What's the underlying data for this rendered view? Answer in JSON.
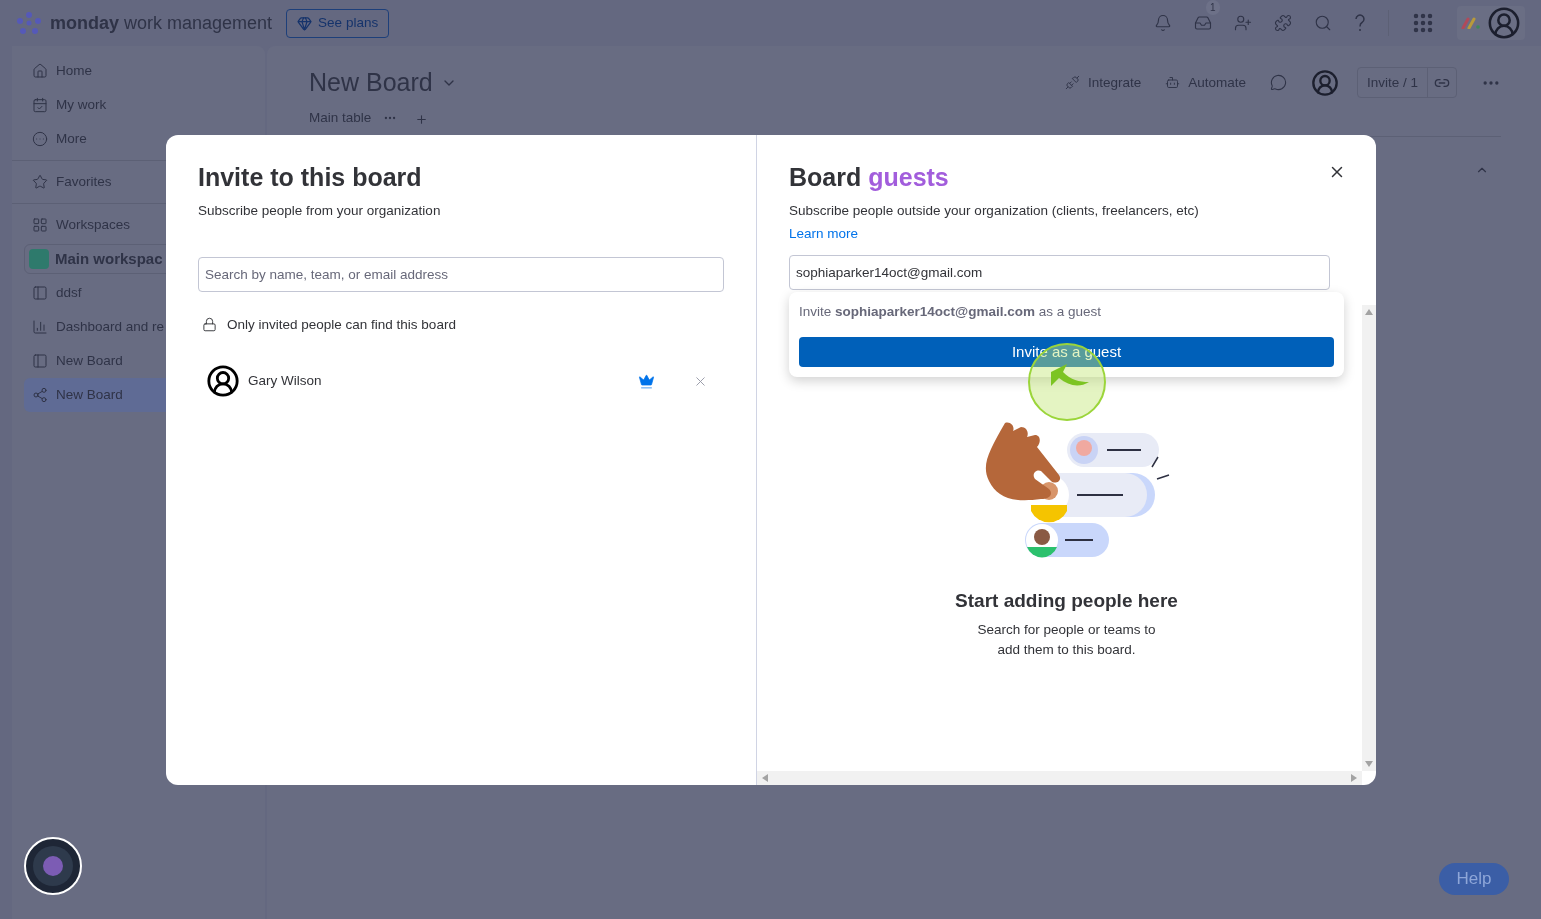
{
  "header": {
    "logo_bold": "monday",
    "logo_rest": "work management",
    "see_plans": "See plans",
    "inbox_badge": "1"
  },
  "sidebar": {
    "items": [
      {
        "kind": "home",
        "label": "Home",
        "selected": false
      },
      {
        "kind": "mywork",
        "label": "My work",
        "selected": false
      },
      {
        "kind": "more",
        "label": "More",
        "selected": false
      },
      {
        "kind": "favorites",
        "label": "Favorites",
        "selected": false
      },
      {
        "kind": "workspaces",
        "label": "Workspaces",
        "selected": false
      }
    ],
    "workspace": "Main workspac",
    "boards": [
      {
        "kind": "board",
        "label": "ddsf",
        "selected": false
      },
      {
        "kind": "dashboard",
        "label": "Dashboard and re",
        "selected": false
      },
      {
        "kind": "board",
        "label": "New Board",
        "selected": false
      },
      {
        "kind": "shared",
        "label": "New Board",
        "selected": true
      }
    ]
  },
  "board": {
    "title": "New Board",
    "tab": "Main table",
    "integrate": "Integrate",
    "automate": "Automate",
    "invite": "Invite / 1"
  },
  "modal": {
    "left": {
      "title": "Invite to this board",
      "subtitle": "Subscribe people from your organization",
      "search_placeholder": "Search by name, team, or email address",
      "privacy": "Only invited people can find this board",
      "members": [
        {
          "name": "Gary Wilson",
          "owner": true
        }
      ]
    },
    "right": {
      "title": "Board",
      "title_accent": "guests",
      "subtitle": "Subscribe people outside your organization (clients, freelancers, etc)",
      "learn_more": "Learn more",
      "email": "sophiaparker14oct@gmail.com",
      "suggestion": "Invite **sophiaparker14oct@gmail.com** as a guest",
      "button": "Invite as a guest",
      "empty_title": "Start adding people here",
      "empty_text": "Search for people or teams to add them to this board."
    }
  },
  "help": "Help"
}
